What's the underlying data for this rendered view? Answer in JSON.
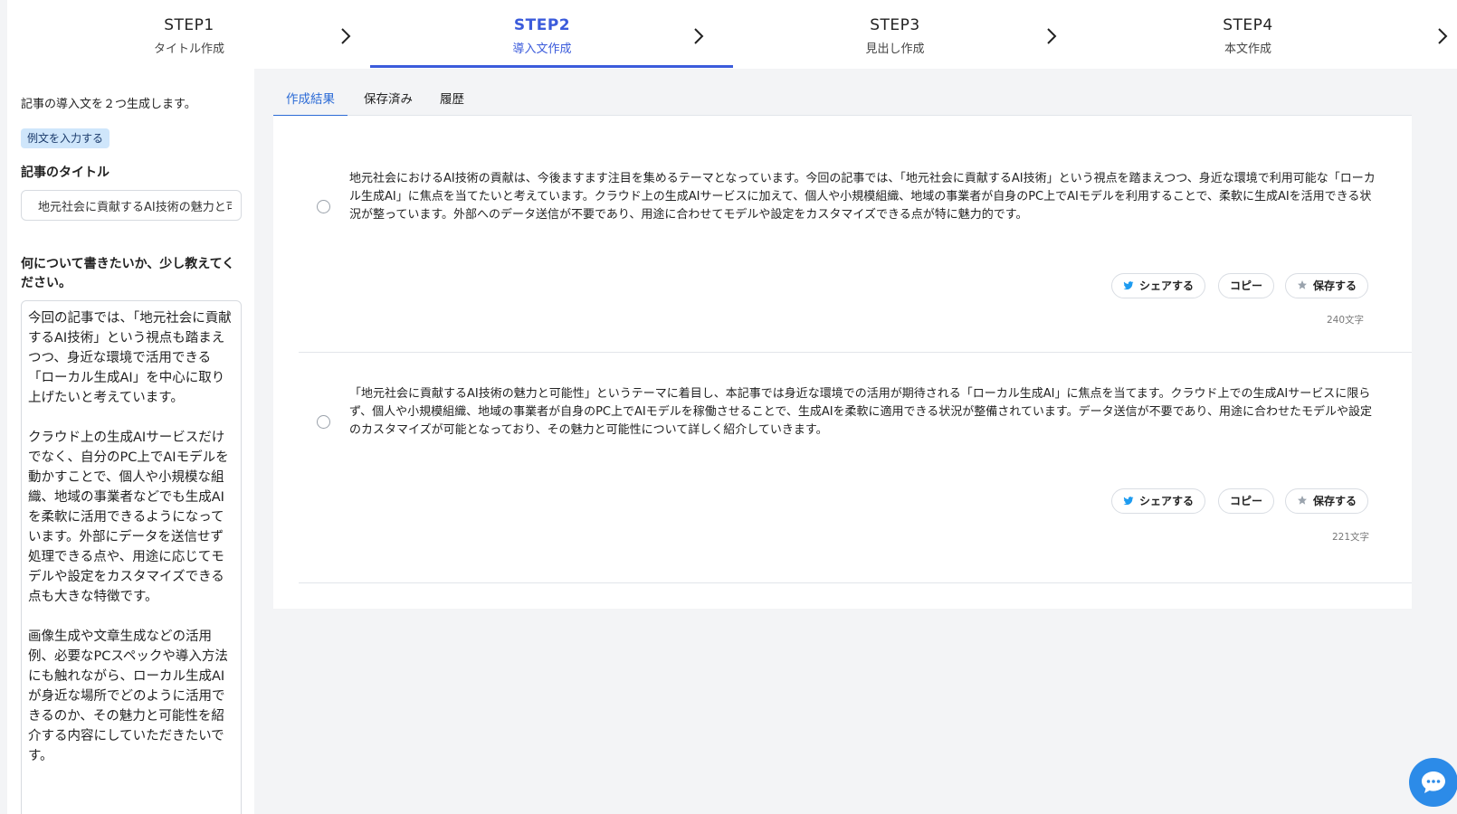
{
  "steps": [
    {
      "num": "STEP1",
      "label": "タイトル作成"
    },
    {
      "num": "STEP2",
      "label": "導入文作成"
    },
    {
      "num": "STEP3",
      "label": "見出し作成"
    },
    {
      "num": "STEP4",
      "label": "本文作成"
    }
  ],
  "active_step": "STEP2",
  "sidebar": {
    "intro": "記事の導入文を２つ生成します。",
    "example_button": "例文を入力する",
    "title_label": "記事のタイトル",
    "title_value": "地元社会に貢献するAI技術の魅力と可能性",
    "about_label": "何について書きたいか、少し教えてください。",
    "about_value": "今回の記事では、「地元社会に貢献するAI技術」という視点も踏まえつつ、身近な環境で活用できる「ローカル生成AI」を中心に取り上げたいと考えています。\n\nクラウド上の生成AIサービスだけでなく、自分のPC上でAIモデルを動かすことで、個人や小規模な組織、地域の事業者などでも生成AIを柔軟に活用できるようになっています。外部にデータを送信せず処理できる点や、用途に応じてモデルや設定をカスタマイズできる点も大きな特徴です。\n\n画像生成や文章生成などの活用例、必要なPCスペックや導入方法にも触れながら、ローカル生成AIが身近な場所でどのように活用できるのか、その魅力と可能性を紹介する内容にしていただきたいです。"
  },
  "tabs": [
    {
      "label": "作成結果",
      "active": true
    },
    {
      "label": "保存済み",
      "active": false
    },
    {
      "label": "履歴",
      "active": false
    }
  ],
  "results": [
    {
      "text": "地元社会におけるAI技術の貢献は、今後ますます注目を集めるテーマとなっています。今回の記事では、「地元社会に貢献するAI技術」という視点を踏まえつつ、身近な環境で利用可能な「ローカル生成AI」に焦点を当てたいと考えています。クラウド上の生成AIサービスに加えて、個人や小規模組織、地域の事業者が自身のPC上でAIモデルを利用することで、柔軟に生成AIを活用できる状況が整っています。外部へのデータ送信が不要であり、用途に合わせてモデルや設定をカスタマイズできる点が特に魅力的です。",
      "share": "シェアする",
      "copy": "コピー",
      "save": "保存する",
      "count": "240文字"
    },
    {
      "text": "「地元社会に貢献するAI技術の魅力と可能性」というテーマに着目し、本記事では身近な環境での活用が期待される「ローカル生成AI」に焦点を当てます。クラウド上での生成AIサービスに限らず、個人や小規模組織、地域の事業者が自身のPC上でAIモデルを稼働させることで、生成AIを柔軟に適用できる状況が整備されています。データ送信が不要であり、用途に合わせたモデルや設定のカスタマイズが可能となっており、その魅力と可能性について詳しく紹介していきます。",
      "share": "シェアする",
      "copy": "コピー",
      "save": "保存する",
      "count": "221文字"
    }
  ],
  "icons": {
    "chevron": "chevron-right-icon",
    "share": "twitter-bird-icon",
    "save": "star-icon",
    "chat": "chat-bubble-icon"
  },
  "colors": {
    "accent": "#3b5bdb",
    "tab_accent": "#2c6bd6",
    "example_bg": "#cfe6fb",
    "chat": "#2c8be8",
    "twitter": "#1d9bf0"
  }
}
